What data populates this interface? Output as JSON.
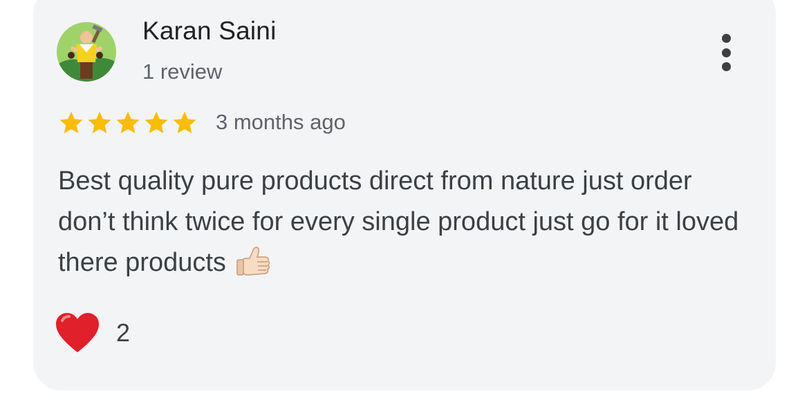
{
  "review": {
    "author_name": "Karan Saini",
    "author_meta": "1 review",
    "rating": 5,
    "max_rating": 5,
    "relative_date": "3 months ago",
    "text": "Best quality pure products direct from nature just order don’t think twice for every single product just go for it loved there products",
    "text_emoji_icon": "thumbs-up-icon",
    "reaction_icon": "heart-icon",
    "reaction_count": "2"
  },
  "colors": {
    "card_background": "#f3f4f6",
    "star": "#fbbc04",
    "heart": "#e0202a",
    "primary_text": "#202124",
    "secondary_text": "#5f6368"
  }
}
